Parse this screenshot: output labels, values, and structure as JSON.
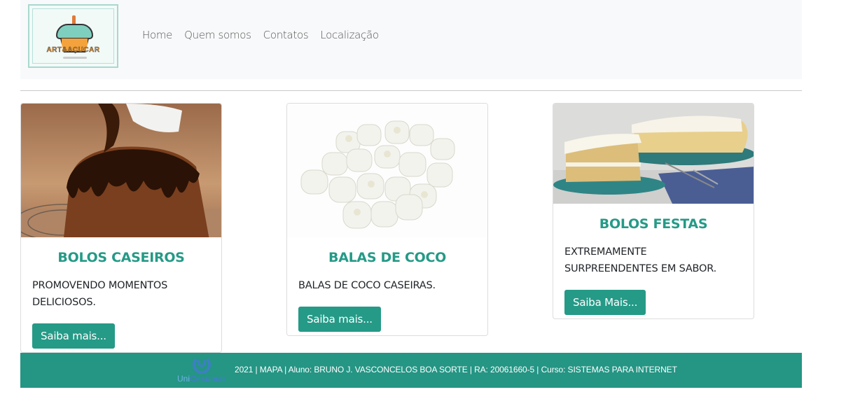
{
  "header": {
    "logo_text": "ART&AÇUCAR",
    "nav": [
      "Home",
      "Quem somos",
      "Contatos",
      "Localização"
    ]
  },
  "cards": [
    {
      "title": "BOLOS CASEIROS",
      "text": "PROMOVENDO MOMENTOS DELICIOSOS.",
      "button": "Saiba mais..."
    },
    {
      "title": "BALAS DE COCO",
      "text": "BALAS DE COCO CASEIRAS.",
      "button": "Saiba mais..."
    },
    {
      "title": "BOLOS FESTAS",
      "text": "EXTREMAMENTE SURPREENDENTES EM SABOR.",
      "button": "Saiba Mais..."
    }
  ],
  "footer": {
    "logo_uni": "Uni",
    "logo_cesumar": "Cesumar",
    "text": "2021 | MAPA | Aluno: BRUNO J. VASCONCELOS BOA SORTE | RA: 20061660-5 | Curso: SISTEMAS PARA INTERNET"
  },
  "colors": {
    "accent": "#259a87",
    "footer_bg": "#259584",
    "navbar_bg": "#f8f9fa"
  }
}
